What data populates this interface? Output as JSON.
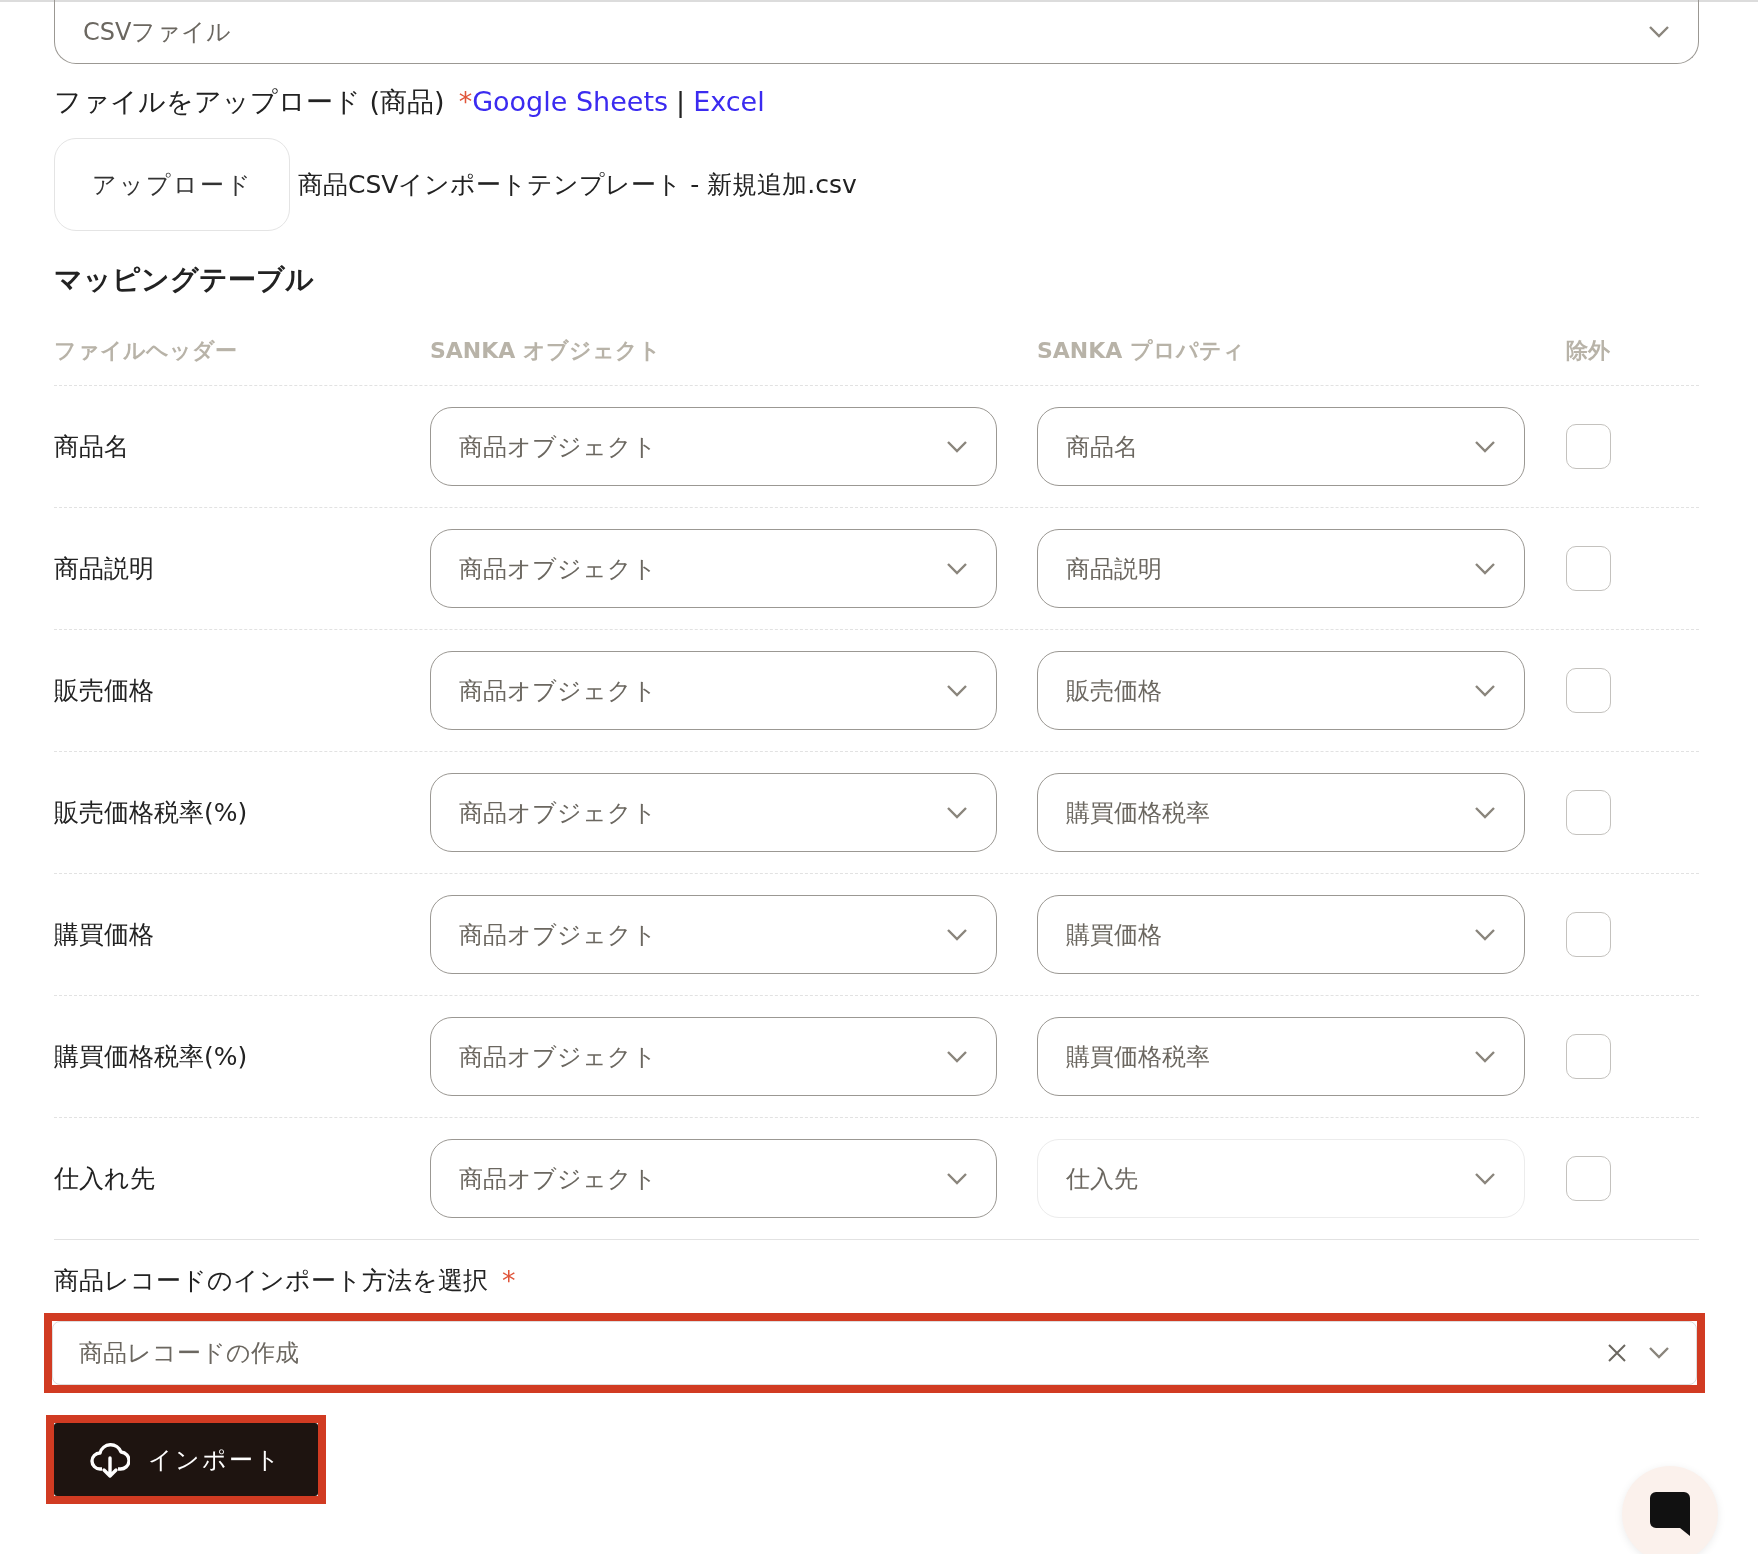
{
  "file_type_select": {
    "value": "CSVファイル"
  },
  "upload": {
    "label": "ファイルをアップロード (商品)",
    "required_mark": "*",
    "links": [
      {
        "text": "Google Sheets"
      },
      {
        "text": "Excel"
      }
    ],
    "separator": "|",
    "button": "アップロード",
    "file_name": "商品CSVインポートテンプレート - 新規追加.csv"
  },
  "mapping": {
    "title": "マッピングテーブル",
    "columns": [
      "ファイルヘッダー",
      "SANKA オブジェクト",
      "SANKA プロパティ",
      "除外"
    ],
    "rows": [
      {
        "header": "商品名",
        "object": "商品オブジェクト",
        "property": "商品名",
        "property_disabled": false,
        "excluded": false
      },
      {
        "header": "商品説明",
        "object": "商品オブジェクト",
        "property": "商品説明",
        "property_disabled": false,
        "excluded": false
      },
      {
        "header": "販売価格",
        "object": "商品オブジェクト",
        "property": "販売価格",
        "property_disabled": false,
        "excluded": false
      },
      {
        "header": "販売価格税率(%)",
        "object": "商品オブジェクト",
        "property": "購買価格税率",
        "property_disabled": false,
        "excluded": false
      },
      {
        "header": "購買価格",
        "object": "商品オブジェクト",
        "property": "購買価格",
        "property_disabled": false,
        "excluded": false
      },
      {
        "header": "購買価格税率(%)",
        "object": "商品オブジェクト",
        "property": "購買価格税率",
        "property_disabled": false,
        "excluded": false
      },
      {
        "header": "仕入れ先",
        "object": "商品オブジェクト",
        "property": "仕入先",
        "property_disabled": true,
        "excluded": false
      }
    ]
  },
  "import_method": {
    "label": "商品レコードのインポート方法を選択",
    "required_mark": "*",
    "value": "商品レコードの作成",
    "highlighted": true
  },
  "import_button": {
    "label": "インポート",
    "highlighted": true
  }
}
